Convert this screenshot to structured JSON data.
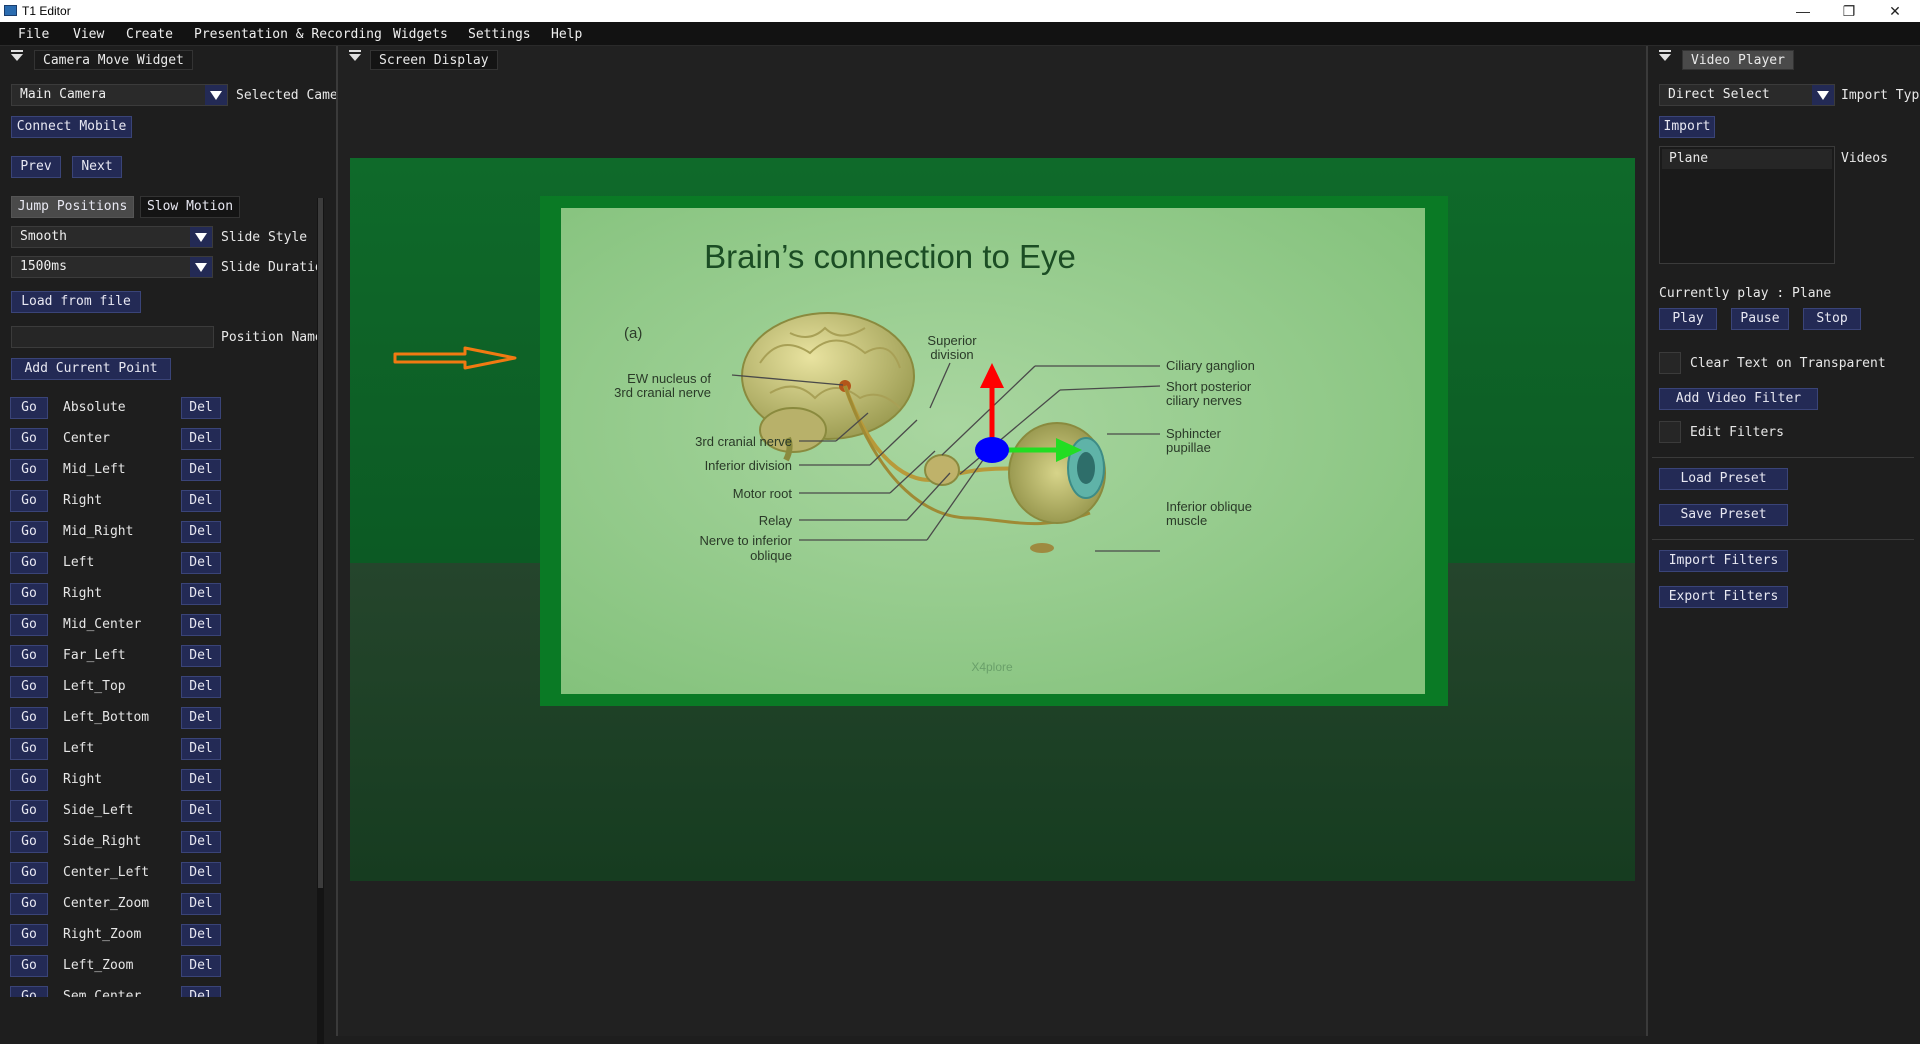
{
  "window": {
    "title": "T1 Editor",
    "minimize": "—",
    "restore": "❐",
    "close": "✕"
  },
  "menu": [
    "File",
    "View",
    "Create",
    "Presentation & Recording",
    "Widgets",
    "Settings",
    "Help"
  ],
  "left_panel": {
    "tab": "Camera Move Widget",
    "camera_select": "Main Camera",
    "camera_select_label": "Selected Came",
    "connect_mobile": "Connect Mobile",
    "prev": "Prev",
    "next": "Next",
    "mode_tabs": [
      "Jump Positions",
      "Slow Motion"
    ],
    "slide_style_value": "Smooth",
    "slide_style_label": "Slide Style",
    "slide_duration_value": "1500ms",
    "slide_duration_label": "Slide Duratio",
    "load_from_file": "Load from file",
    "position_name_label": "Position Name",
    "position_name_value": "",
    "add_current_point": "Add Current Point",
    "go_label": "Go",
    "del_label": "Del",
    "positions": [
      "Absolute",
      "Center",
      "Mid_Left",
      "Right",
      "Mid_Right",
      "Left",
      "Right",
      "Mid_Center",
      "Far_Left",
      "Left_Top",
      "Left_Bottom",
      "Left",
      "Right",
      "Side_Left",
      "Side_Right",
      "Center_Left",
      "Center_Zoom",
      "Right_Zoom",
      "Left_Zoom",
      "Sem_Center"
    ]
  },
  "center_panel": {
    "tab": "Screen Display",
    "slide": {
      "title": "Brain’s connection to Eye",
      "panel_label": "(a)",
      "labels": {
        "ew_nucleus": "EW nucleus of",
        "ew_nucleus2": "3rd cranial nerve",
        "superior": "Superior",
        "superior2": "division",
        "cranial": "3rd cranial nerve",
        "inferior_div": "Inferior division",
        "motor_root": "Motor root",
        "relay": "Relay",
        "nerve_inf": "Nerve to inferior",
        "nerve_inf2": "oblique",
        "ciliary_ganglion": "Ciliary ganglion",
        "short_post": "Short posterior",
        "short_post2": "ciliary nerves",
        "sphincter": "Sphincter",
        "sphincter2": "pupillae",
        "inf_oblique": "Inferior oblique",
        "inf_oblique2": "muscle"
      },
      "watermark": "X4plore"
    }
  },
  "right_panel": {
    "tab": "Video Player",
    "select_value": "Direct Select",
    "import_type_label": "Import Typ",
    "import": "Import",
    "videos_label": "Videos",
    "video_list": [
      "Plane"
    ],
    "currently_play": "Currently play : Plane",
    "play": "Play",
    "pause": "Pause",
    "stop": "Stop",
    "clear_text": "Clear Text on Transparent",
    "add_video_filter": "Add Video Filter",
    "edit_filters": "Edit Filters",
    "load_preset": "Load Preset",
    "save_preset": "Save Preset",
    "import_filters": "Import Filters",
    "export_filters": "Export Filters"
  }
}
